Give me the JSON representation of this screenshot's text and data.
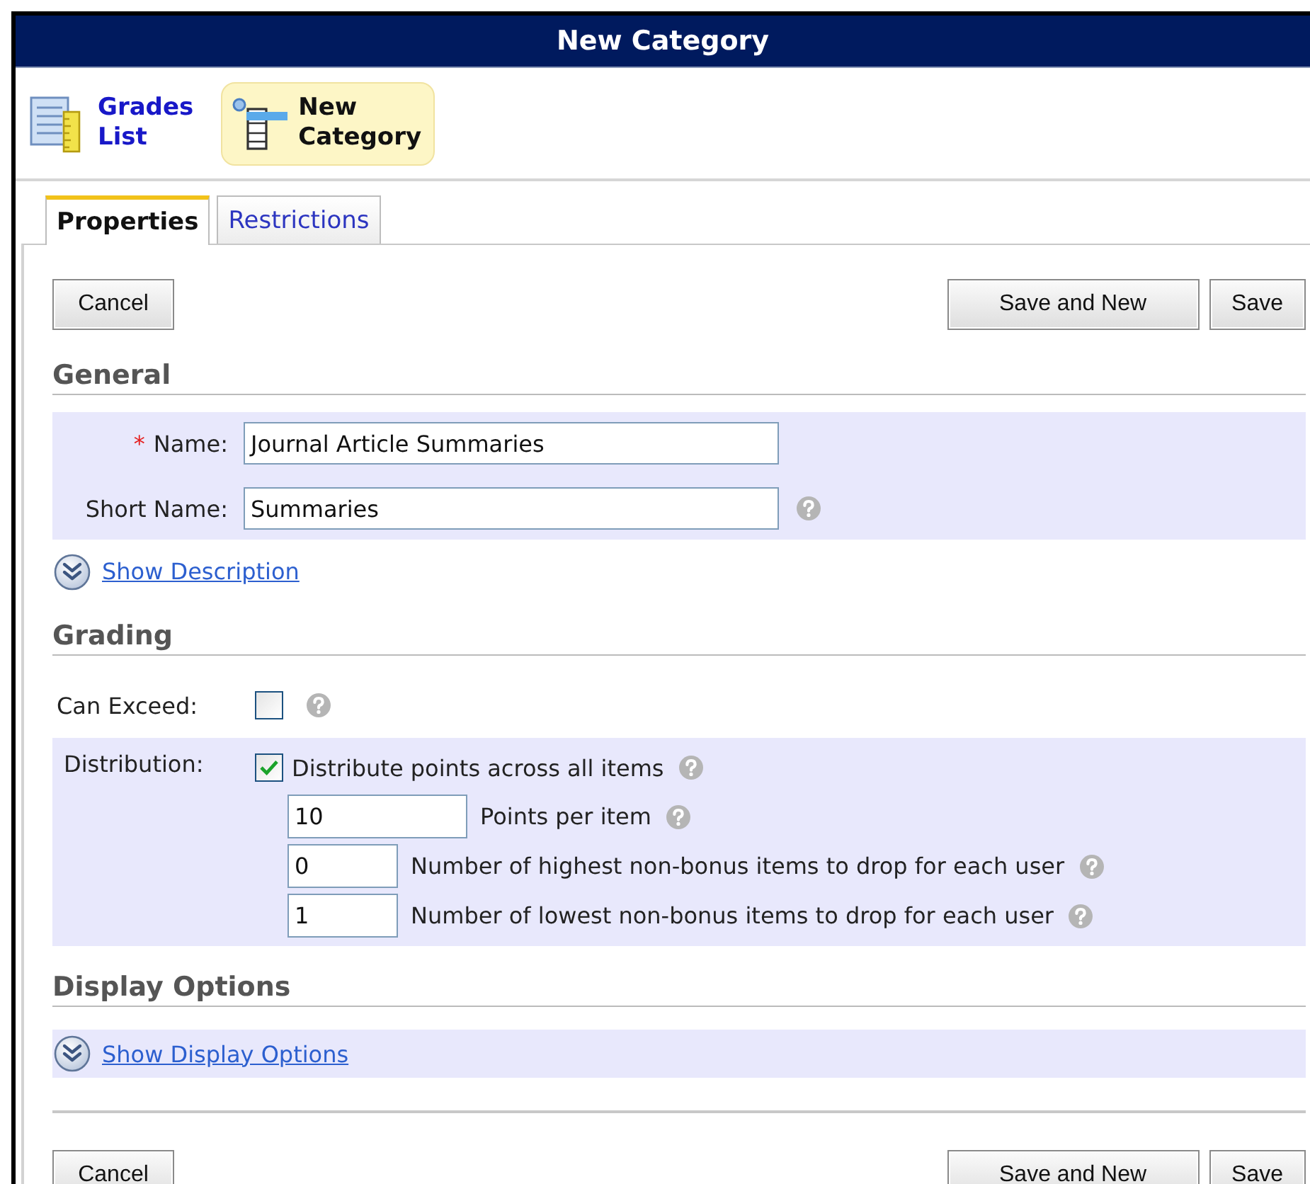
{
  "window": {
    "title": "New Category"
  },
  "nav": [
    {
      "label": "Grades List",
      "kind": "list",
      "selected": false
    },
    {
      "label": "New Category",
      "kind": "new",
      "selected": true
    }
  ],
  "tabs": [
    {
      "label": "Properties",
      "selected": true
    },
    {
      "label": "Restrictions",
      "selected": false
    }
  ],
  "top_buttons": {
    "left": [
      "Cancel"
    ],
    "right": [
      "Save and New",
      "Save"
    ]
  },
  "general": {
    "heading": "General",
    "fields": [
      {
        "label": "Name:",
        "required_mark": "*",
        "value": "Journal Article Summaries",
        "help": false
      },
      {
        "label": "Short Name:",
        "value": "Summaries",
        "help": true
      }
    ],
    "link": "Show Description"
  },
  "grading": {
    "heading": "Grading",
    "can_exceed": {
      "label": "Can Exceed:",
      "checked": false,
      "help": true
    },
    "distribution": {
      "label": "Distribution:",
      "checked": true,
      "option": "Distribute points across all items",
      "help": true,
      "inputs": [
        {
          "value": "10",
          "label": "Points per item",
          "wide": true
        },
        {
          "value": "0",
          "label": "Number of highest non-bonus items to drop for each user",
          "wide": false
        },
        {
          "value": "1",
          "label": "Number of lowest non-bonus items to drop for each user",
          "wide": false
        }
      ]
    }
  },
  "display_options": {
    "heading": "Display Options",
    "link": "Show Display Options"
  },
  "bottom_buttons": {
    "left": [
      "Cancel"
    ],
    "right": [
      "Save and New",
      "Save"
    ]
  }
}
